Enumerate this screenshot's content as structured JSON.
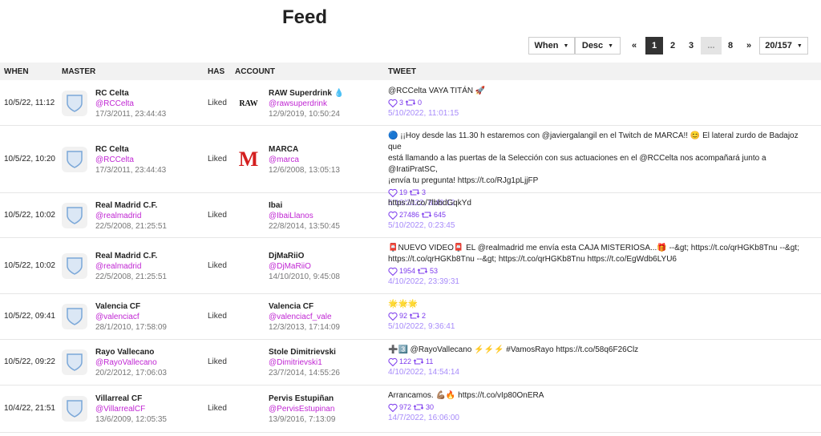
{
  "page": {
    "title": "Feed"
  },
  "controls": {
    "sort_field": "When",
    "sort_order": "Desc",
    "prev": "«",
    "next": "»",
    "pages": [
      "1",
      "2",
      "3",
      "...",
      "8"
    ],
    "page_size": "20/157"
  },
  "columns": {
    "when": "WHEN",
    "master": "MASTER",
    "has": "HAS",
    "account": "ACCOUNT",
    "tweet": "TWEET"
  },
  "rows": [
    {
      "when": "10/5/22, 11:12",
      "master": {
        "name": "RC Celta",
        "handle": "@RCCelta",
        "date": "17/3/2011, 23:44:43"
      },
      "has": "Liked",
      "account": {
        "name": "RAW Superdrink 💧",
        "handle": "@rawsuperdrink",
        "date": "12/9/2019, 10:50:24",
        "logo": "RAW"
      },
      "tweet": {
        "lines": [
          "@RCCelta VAYA TITÁN 🚀"
        ],
        "likes": "3",
        "retweets": "0",
        "date": "5/10/2022, 11:01:15"
      }
    },
    {
      "when": "10/5/22, 10:20",
      "master": {
        "name": "RC Celta",
        "handle": "@RCCelta",
        "date": "17/3/2011, 23:44:43"
      },
      "has": "Liked",
      "account": {
        "name": "MARCA",
        "handle": "@marca",
        "date": "12/6/2008, 13:05:13",
        "logo": "M"
      },
      "tweet": {
        "lines": [
          "🔵 ¡¡Hoy desde las 11.30 h estaremos con @javiergalangil en el Twitch de MARCA!! 😊 El lateral zurdo de Badajoz que",
          "está llamando a las puertas de la Selección con sus actuaciones en el @RCCelta nos acompañará junto a @IratiPratSC,",
          "¡envía tu pregunta! https://t.co/RJg1pLjjFP"
        ],
        "likes": "19",
        "retweets": "3",
        "date": "5/10/2022, 8:49:12"
      }
    },
    {
      "when": "10/5/22, 10:02",
      "master": {
        "name": "Real Madrid C.F.",
        "handle": "@realmadrid",
        "date": "22/5/2008, 21:25:51"
      },
      "has": "Liked",
      "account": {
        "name": "Ibai",
        "handle": "@IbaiLlanos",
        "date": "22/8/2014, 13:50:45",
        "logo": ""
      },
      "tweet": {
        "lines": [
          "https://t.co/7lbbdGqkYd"
        ],
        "likes": "27486",
        "retweets": "645",
        "date": "5/10/2022, 0:23:45"
      }
    },
    {
      "when": "10/5/22, 10:02",
      "master": {
        "name": "Real Madrid C.F.",
        "handle": "@realmadrid",
        "date": "22/5/2008, 21:25:51"
      },
      "has": "Liked",
      "account": {
        "name": "DjMaRiiO",
        "handle": "@DjMaRiiO",
        "date": "14/10/2010, 9:45:08",
        "logo": ""
      },
      "tweet": {
        "lines": [
          "📮NUEVO VIDEO📮 EL @realmadrid me envía esta CAJA MISTERIOSA...🎁 --&gt; https://t.co/qrHGKb8Tnu --&gt;",
          "https://t.co/qrHGKb8Tnu --&gt; https://t.co/qrHGKb8Tnu https://t.co/EgWdb6LYU6"
        ],
        "likes": "1954",
        "retweets": "53",
        "date": "4/10/2022, 23:39:31"
      }
    },
    {
      "when": "10/5/22, 09:41",
      "master": {
        "name": "Valencia CF",
        "handle": "@valenciacf",
        "date": "28/1/2010, 17:58:09"
      },
      "has": "Liked",
      "account": {
        "name": "Valencia CF",
        "handle": "@valenciacf_vale",
        "date": "12/3/2013, 17:14:09",
        "logo": ""
      },
      "tweet": {
        "lines": [
          "🌟🌟🌟"
        ],
        "likes": "92",
        "retweets": "2",
        "date": "5/10/2022, 9:36:41"
      }
    },
    {
      "when": "10/5/22, 09:22",
      "master": {
        "name": "Rayo Vallecano",
        "handle": "@RayoVallecano",
        "date": "20/2/2012, 17:06:03"
      },
      "has": "Liked",
      "account": {
        "name": "Stole Dimitrievski",
        "handle": "@Dimitrievski1",
        "date": "23/7/2014, 14:55:26",
        "logo": ""
      },
      "tweet": {
        "lines": [
          "➕3️⃣ @RayoVallecano ⚡⚡⚡ #VamosRayo https://t.co/58q6F26Clz"
        ],
        "likes": "122",
        "retweets": "11",
        "date": "4/10/2022, 14:54:14"
      }
    },
    {
      "when": "10/4/22, 21:51",
      "master": {
        "name": "Villarreal CF",
        "handle": "@VillarrealCF",
        "date": "13/6/2009, 12:05:35"
      },
      "has": "Liked",
      "account": {
        "name": "Pervis Estupiñan",
        "handle": "@PervisEstupinan",
        "date": "13/9/2016, 7:13:09",
        "logo": ""
      },
      "tweet": {
        "lines": [
          "Arrancamos. 💪🏽🔥 https://t.co/vIp80OnERA"
        ],
        "likes": "972",
        "retweets": "30",
        "date": "14/7/2022, 16:06:00"
      }
    }
  ]
}
